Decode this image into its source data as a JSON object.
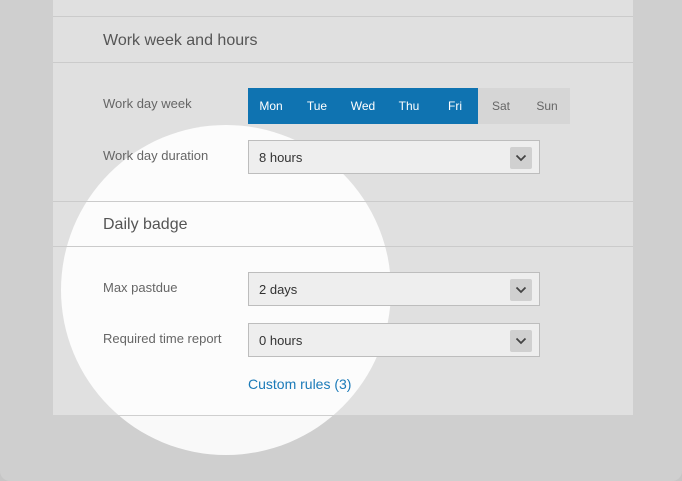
{
  "sections": {
    "work_week": {
      "title": "Work week and hours",
      "work_day_week_label": "Work day week",
      "days": [
        {
          "label": "Mon",
          "selected": true
        },
        {
          "label": "Tue",
          "selected": true
        },
        {
          "label": "Wed",
          "selected": true
        },
        {
          "label": "Thu",
          "selected": true
        },
        {
          "label": "Fri",
          "selected": true
        },
        {
          "label": "Sat",
          "selected": false
        },
        {
          "label": "Sun",
          "selected": false
        }
      ],
      "work_day_duration_label": "Work day duration",
      "work_day_duration_value": "8 hours"
    },
    "daily_badge": {
      "title": "Daily badge",
      "max_pastdue_label": "Max pastdue",
      "max_pastdue_value": "2 days",
      "required_time_report_label": "Required time report",
      "required_time_report_value": "0 hours",
      "custom_rules_link": "Custom rules (3)"
    }
  },
  "colors": {
    "selected_day": "#0f73b1",
    "link": "#1a7ab8"
  }
}
